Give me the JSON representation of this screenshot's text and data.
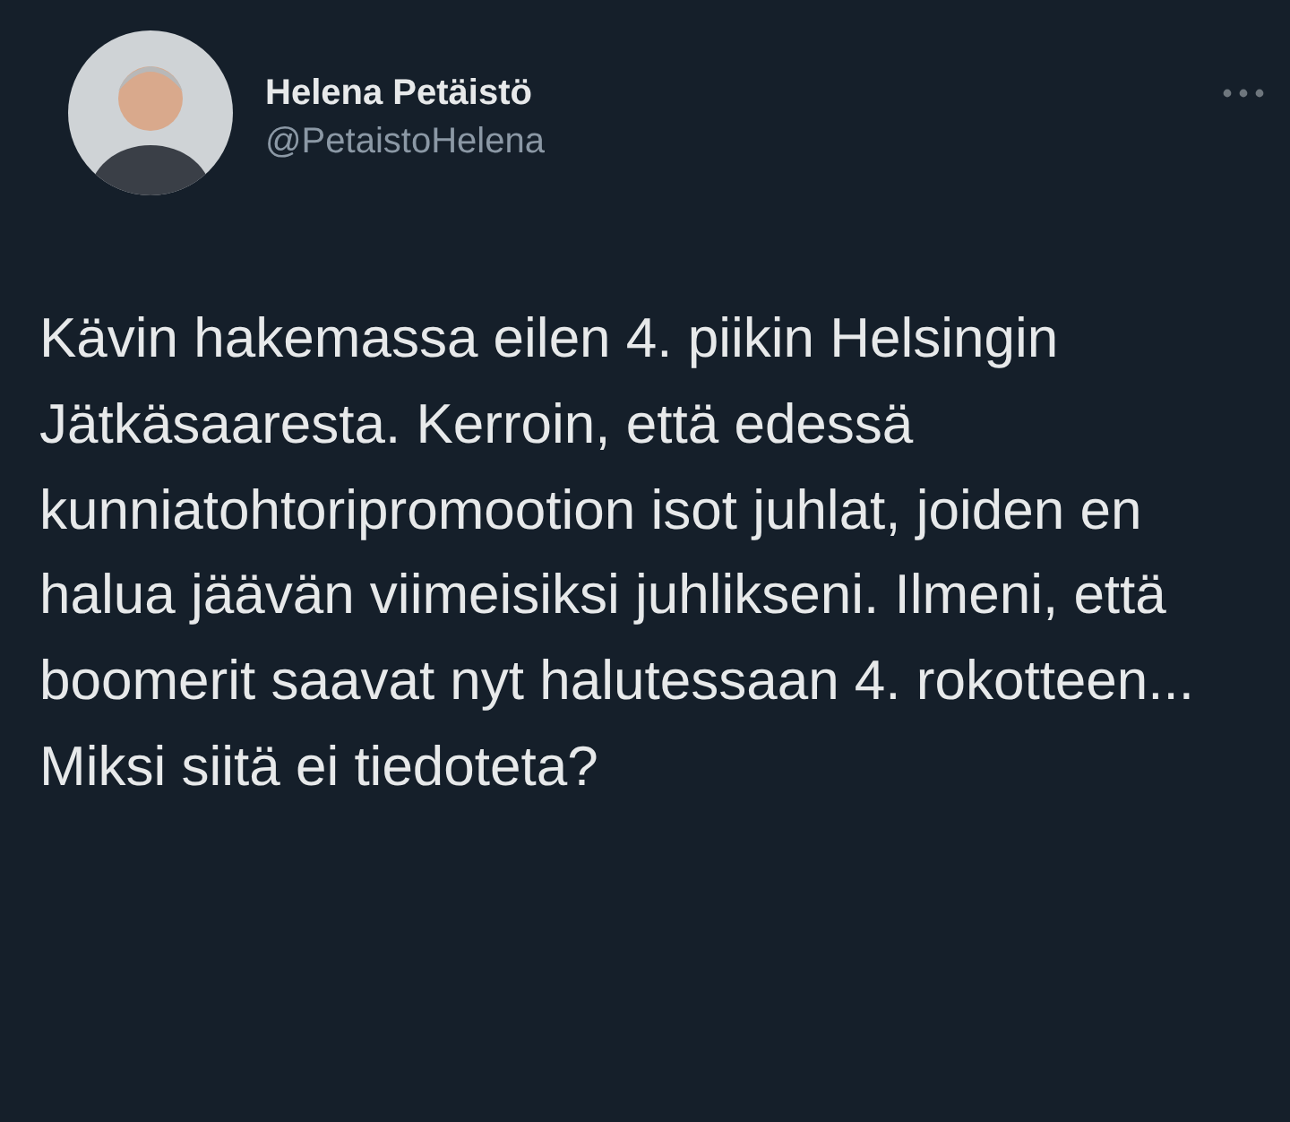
{
  "author": {
    "name": "Helena Petäistö",
    "handle": "@PetaistoHelena"
  },
  "tweet": {
    "text": "Kävin hakemassa eilen 4. piikin Helsingin Jätkäsaaresta. Kerroin, että edessä kunniatohtoripromootion isot juhlat, joiden en halua jäävän viimeisiksi juhlikseni. Ilmeni, että boomerit saavat nyt halutessaan 4. rokotteen... Miksi siitä ei tiedoteta?"
  }
}
